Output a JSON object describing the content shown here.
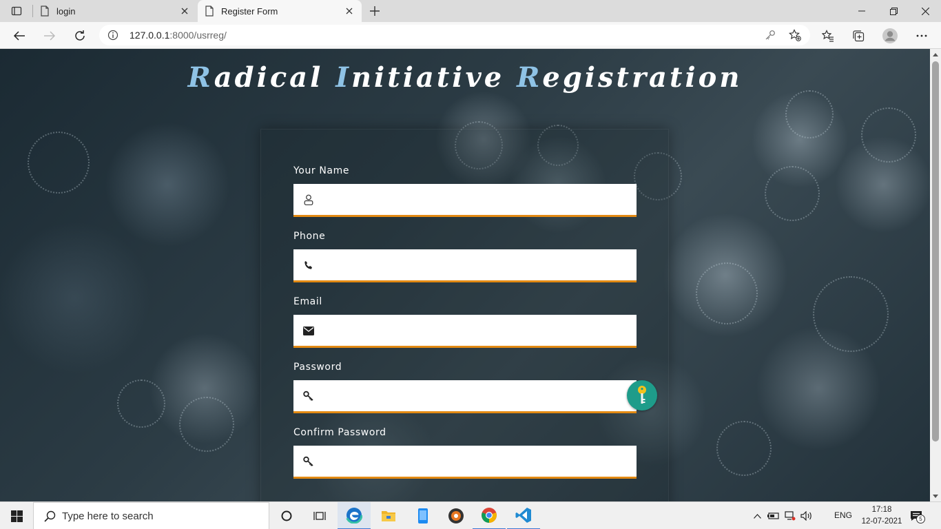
{
  "browser": {
    "tabs": [
      {
        "title": "login",
        "active": false
      },
      {
        "title": "Register Form",
        "active": true
      }
    ],
    "address": {
      "host": "127.0.0.1",
      "path": ":8000/usrreg/"
    }
  },
  "page": {
    "title": {
      "words": [
        {
          "cap": "R",
          "rest": "adical"
        },
        {
          "cap": "I",
          "rest": "nitiative"
        },
        {
          "cap": "R",
          "rest": "egistration"
        }
      ]
    },
    "form": {
      "fields": [
        {
          "label": "Your Name",
          "icon": "user-icon",
          "value": ""
        },
        {
          "label": "Phone",
          "icon": "phone-icon",
          "value": ""
        },
        {
          "label": "Email",
          "icon": "envelope-icon",
          "value": ""
        },
        {
          "label": "Password",
          "icon": "key-icon",
          "value": ""
        },
        {
          "label": "Confirm Password",
          "icon": "key-icon",
          "value": ""
        }
      ]
    },
    "colors": {
      "title_accent": "#8fc3e6",
      "field_underline": "#e38a13",
      "password_badge": "#1e9c8a"
    }
  },
  "taskbar": {
    "search_placeholder": "Type here to search",
    "apps": [
      "edge-icon",
      "file-explorer-icon",
      "phone-app-icon",
      "media-app-icon",
      "chrome-icon",
      "vscode-icon"
    ],
    "language": "ENG",
    "time": "17:18",
    "date": "12-07-2021",
    "notification_count": "5"
  }
}
